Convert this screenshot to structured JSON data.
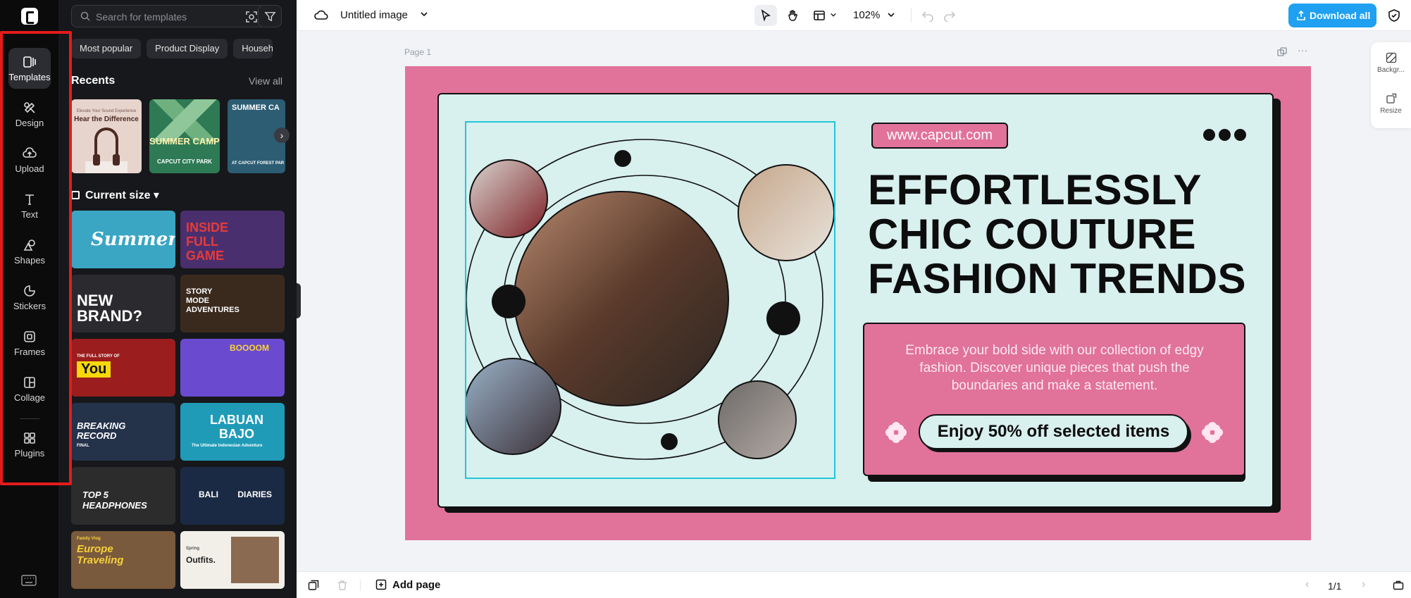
{
  "rail": {
    "items": [
      {
        "label": "Templates",
        "icon": "templates-icon",
        "active": true
      },
      {
        "label": "Design",
        "icon": "design-icon"
      },
      {
        "label": "Upload",
        "icon": "upload-icon"
      },
      {
        "label": "Text",
        "icon": "text-icon"
      },
      {
        "label": "Shapes",
        "icon": "shapes-icon"
      },
      {
        "label": "Stickers",
        "icon": "stickers-icon"
      },
      {
        "label": "Frames",
        "icon": "frames-icon"
      },
      {
        "label": "Collage",
        "icon": "collage-icon"
      },
      {
        "label": "Plugins",
        "icon": "plugins-icon"
      }
    ],
    "highlight_color": "#e41b1b"
  },
  "panel": {
    "search_placeholder": "Search for templates",
    "chips": [
      "Most popular",
      "Product Display",
      "Househo"
    ],
    "recents_title": "Recents",
    "view_all": "View all",
    "recents": [
      {
        "title": "Hear the Difference",
        "kicker": "Elevate Your Sound Experience"
      },
      {
        "title": "SUMMER CAMP",
        "sub": "CAPCUT CITY PARK"
      },
      {
        "title": "SUMMER CA",
        "sub": "AT CAPCUT FOREST PAR"
      }
    ],
    "current_size": "Current size",
    "tiles": [
      {
        "title": "Summer",
        "bg": "#3aa6c4"
      },
      {
        "title": "INSIDE FULL GAME",
        "bg": "#4a2f6e"
      },
      {
        "title": "NEW BRAND?",
        "bg": "#2b2b2f"
      },
      {
        "title": "STORY MODE ADVENTURES",
        "bg": "#3a2a1e"
      },
      {
        "title": "You",
        "kicker": "THE FULL STORY OF",
        "bg": "#9b1d1d"
      },
      {
        "title": "BOOOOM",
        "bg": "#6a4bd0"
      },
      {
        "title": "BREAKING RECORD",
        "sub": "FINAL",
        "bg": "#24324a"
      },
      {
        "title": "LABUAN BAJO",
        "sub": "The Ultimate Indonesian Adventure",
        "bg": "#1f9bb8"
      },
      {
        "title": "TOP 5 HEADPHONES",
        "bg": "#2c2c2c"
      },
      {
        "title": "BALI DIARIES",
        "bg": "#1b2a44"
      },
      {
        "title": "Europe Traveling",
        "kicker": "Family Vlog",
        "bg": "#7a5a3c"
      },
      {
        "title": "Outfits.",
        "kicker": "Spring",
        "bg": "#f2efe9"
      }
    ]
  },
  "topbar": {
    "doc_title": "Untitled image",
    "zoom": "102%",
    "download_label": "Download all",
    "download_color": "#1fa0f0"
  },
  "workspace": {
    "page_label": "Page 1",
    "canvas_bg": "#e17299",
    "card_bg": "#d8f0ee",
    "design": {
      "url": "www.capcut.com",
      "headline": "EFFORTLESSLY CHIC COUTURE FASHION TRENDS",
      "body": "Embrace your bold side with our collection of edgy fashion. Discover unique pieces that push the boundaries and make a statement.",
      "cta": "Enjoy 50% off selected items"
    }
  },
  "side_panel": {
    "background_label": "Backgr...",
    "resize_label": "Resize"
  },
  "bottombar": {
    "add_page": "Add page",
    "pager": "1/1"
  }
}
